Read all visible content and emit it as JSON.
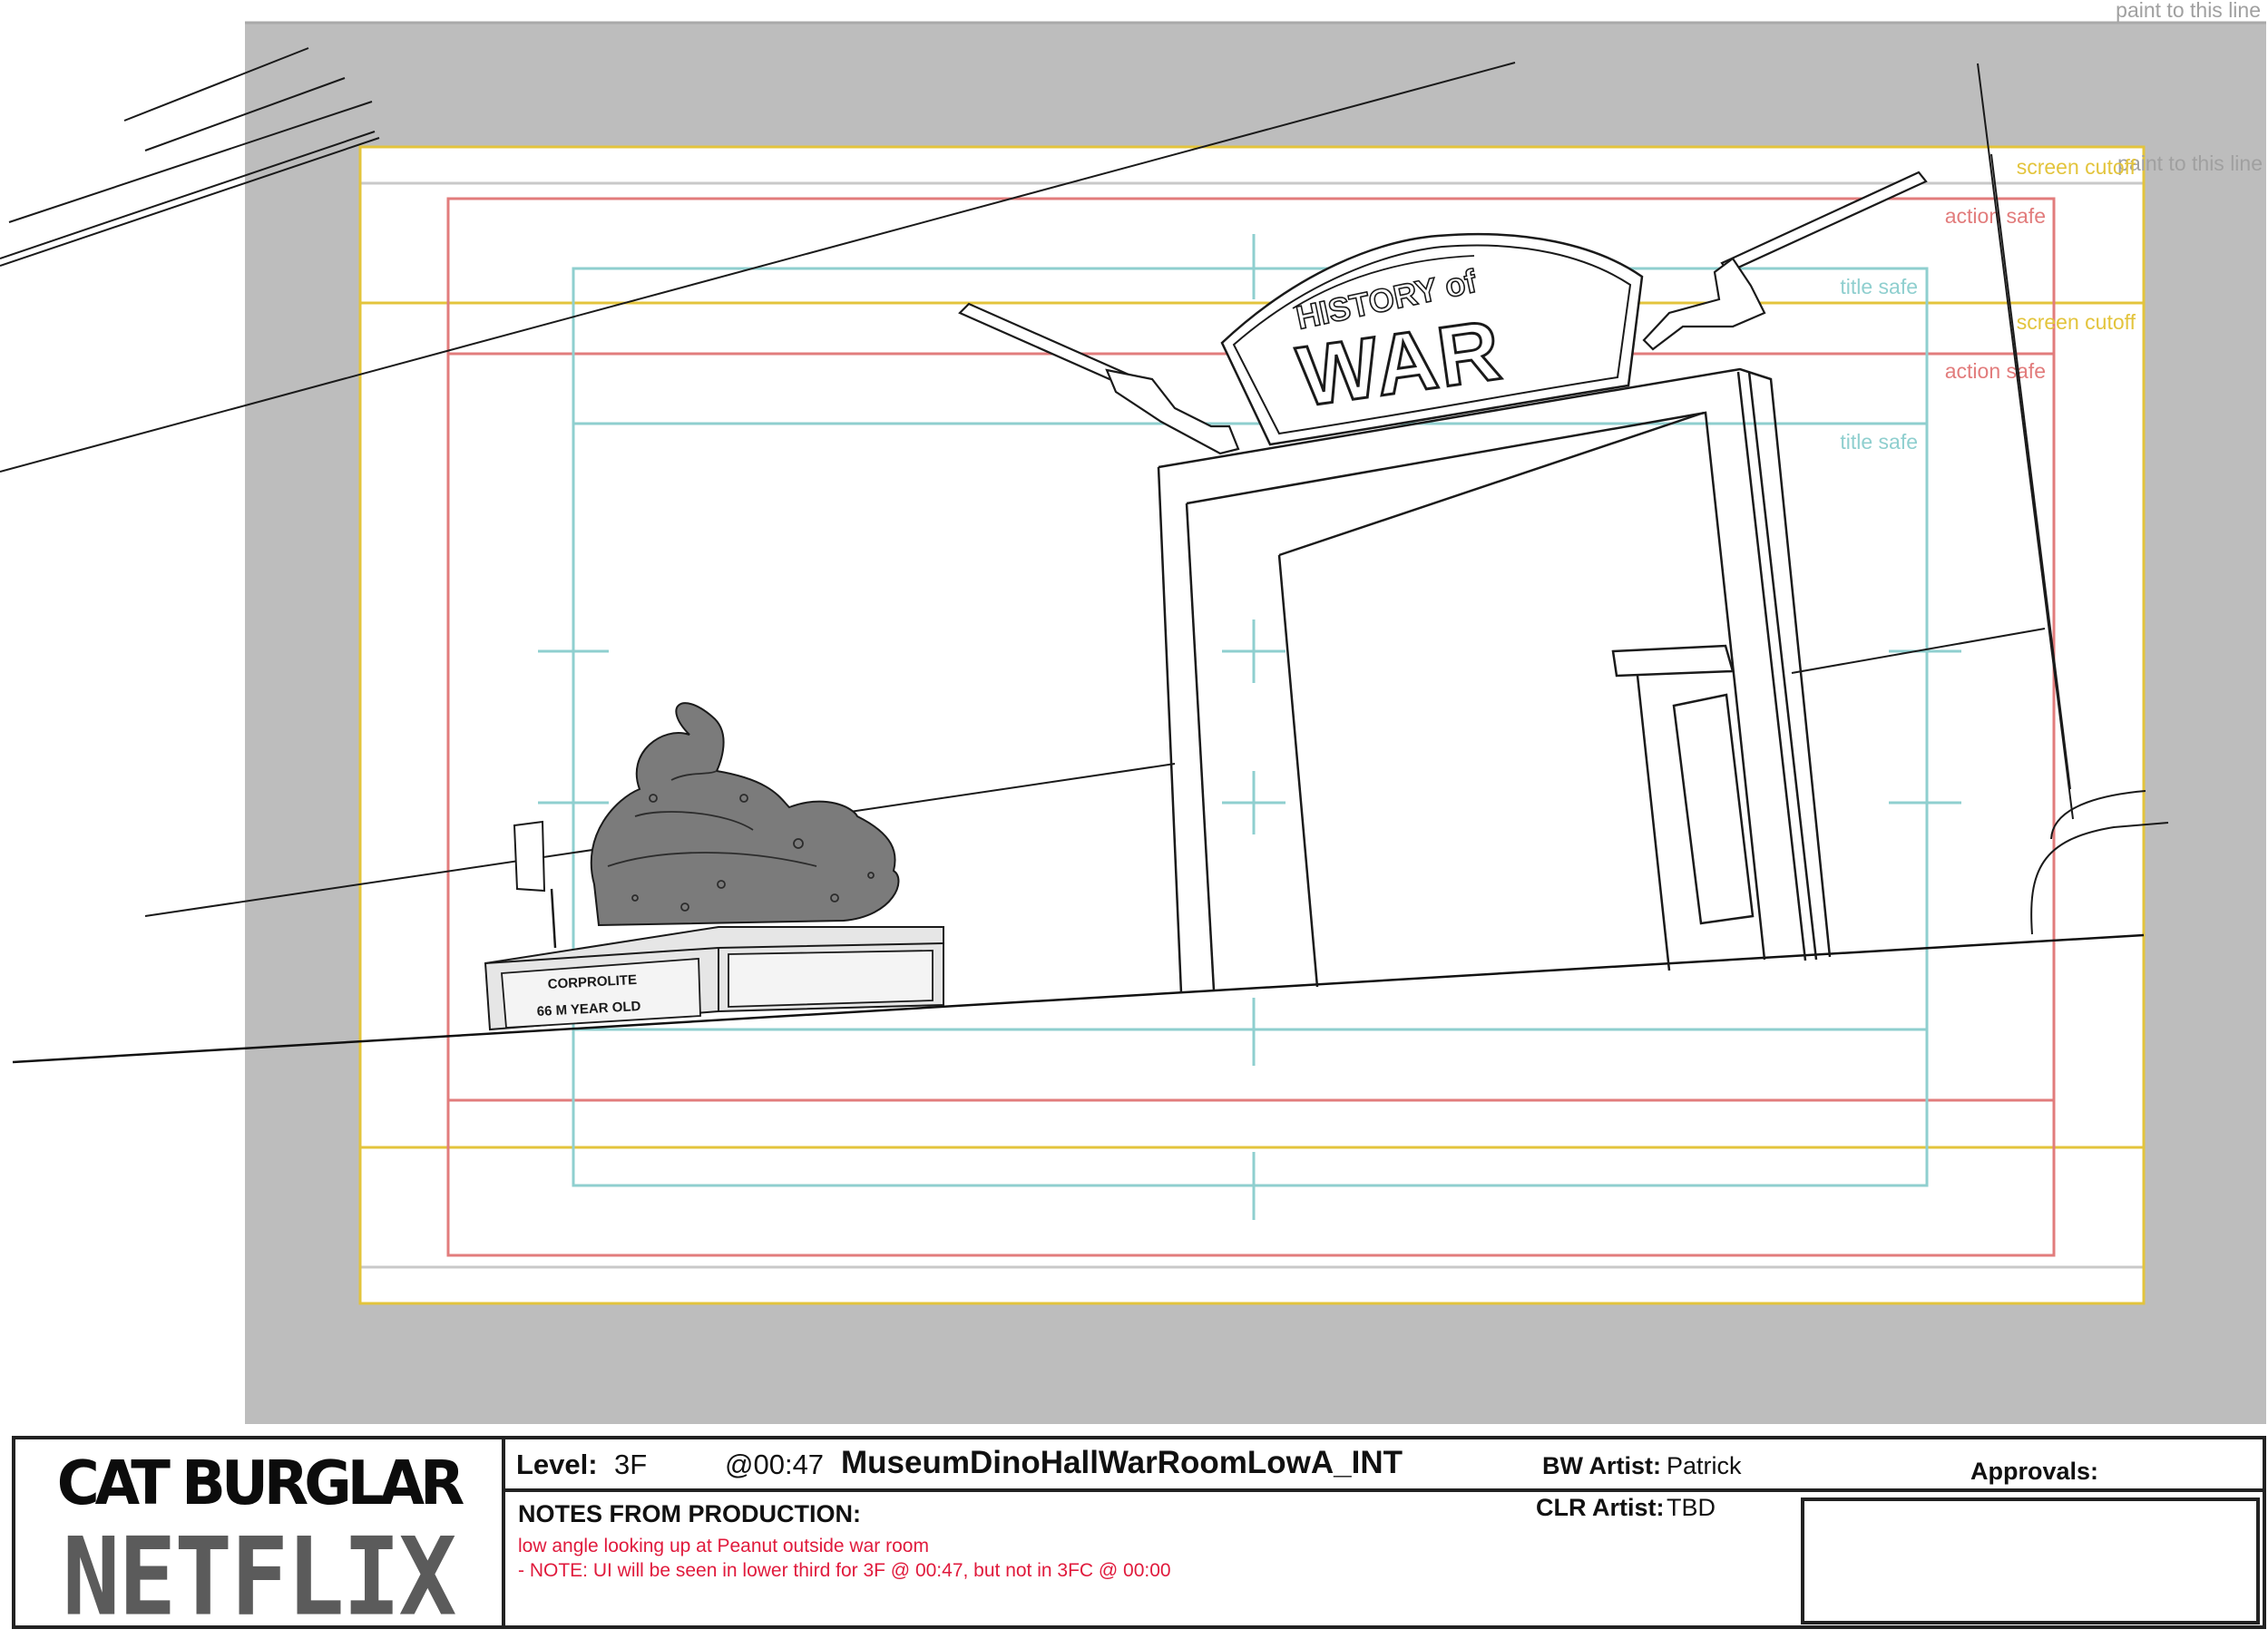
{
  "frame_guides": {
    "paint_line_top": "paint to this line",
    "paint_line_inner": "paint to this line",
    "screen_cutoff": "screen cutoff",
    "action_safe": "action safe",
    "title_safe": "title safe"
  },
  "artwork": {
    "sign_top": "HISTORY of",
    "sign_main": "WAR",
    "plaque_line1": "CORPROLITE",
    "plaque_line2": "66 M YEAR OLD"
  },
  "slate": {
    "show_title": "CAT BURGLAR",
    "network": "NETFLIX",
    "level_label": "Level:",
    "level_value": "3F",
    "timecode": "@00:47",
    "scene_name": "MuseumDinoHallWarRoomLowA_INT",
    "bw_artist_label": "BW Artist:",
    "bw_artist_value": "Patrick",
    "clr_artist_label": "CLR Artist:",
    "clr_artist_value": "TBD",
    "approvals_label": "Approvals:",
    "notes_heading": "NOTES FROM PRODUCTION:",
    "notes_line1": "low angle looking up at Peanut outside war room",
    "notes_line2": "- NOTE: UI will be seen in lower third for 3F @ 00:47, but not in 3FC @ 00:00"
  },
  "colors": {
    "gray_frame": "#bdbdbd",
    "screen_cutoff": "#e3c43c",
    "action_safe": "#e27c7c",
    "title_safe": "#8fcfcf",
    "notes_text": "#e01a3c",
    "sketch_line": "#1a1a1a",
    "statue_fill": "#7b7b7b"
  }
}
